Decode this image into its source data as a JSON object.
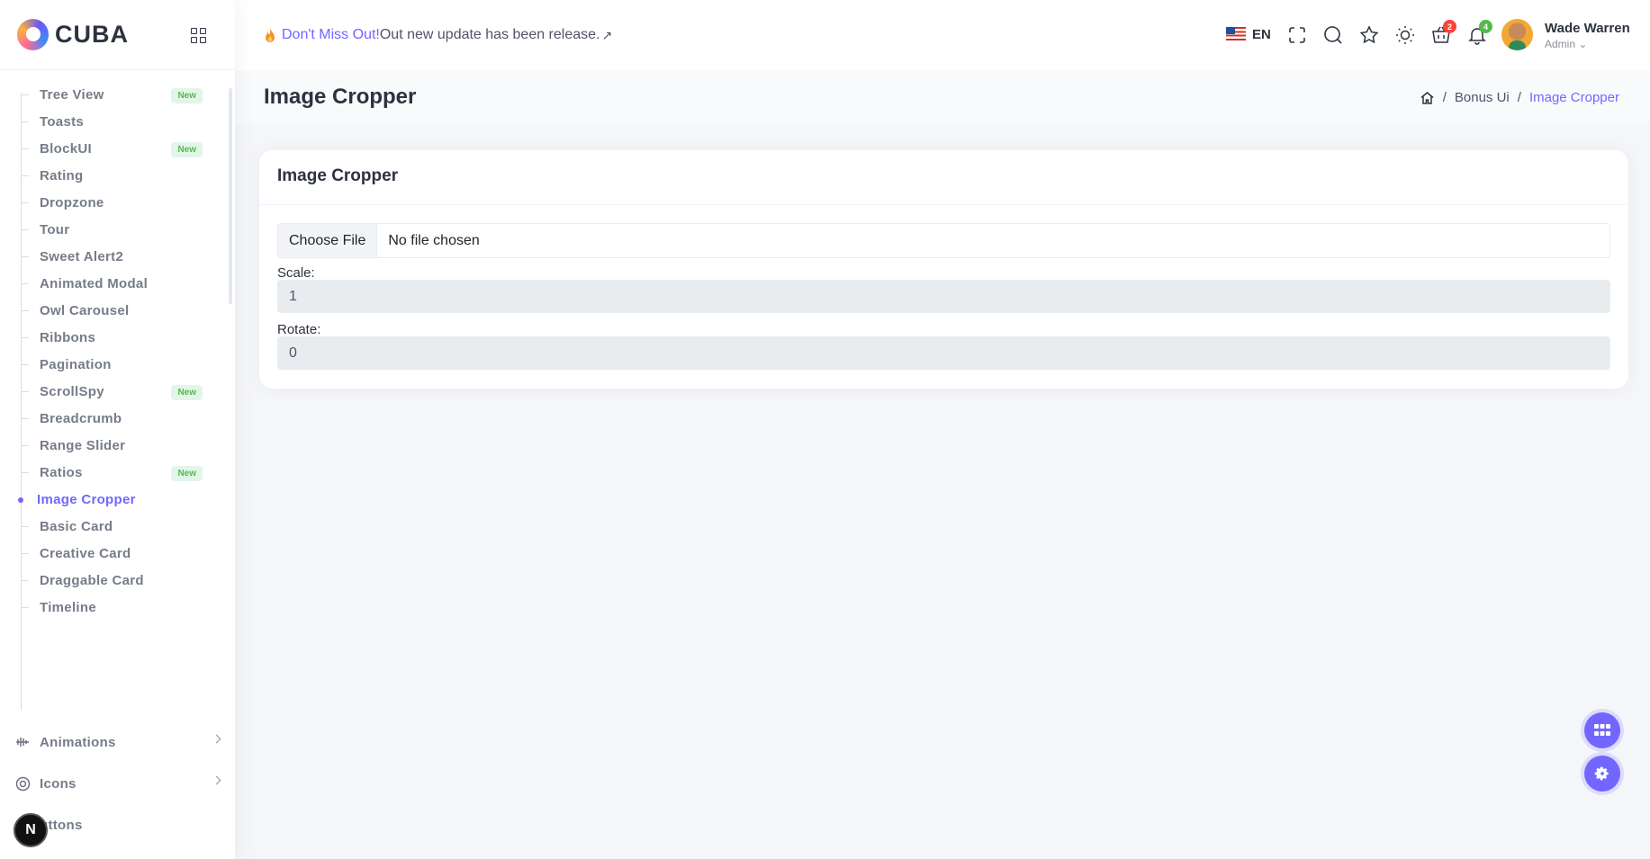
{
  "brand": {
    "name": "CUBA"
  },
  "sidebar": {
    "sub_items": [
      {
        "label": "Tree View",
        "badge": "New"
      },
      {
        "label": "Toasts",
        "badge": ""
      },
      {
        "label": "BlockUI",
        "badge": "New"
      },
      {
        "label": "Rating",
        "badge": ""
      },
      {
        "label": "Dropzone",
        "badge": ""
      },
      {
        "label": "Tour",
        "badge": ""
      },
      {
        "label": "Sweet Alert2",
        "badge": ""
      },
      {
        "label": "Animated Modal",
        "badge": ""
      },
      {
        "label": "Owl Carousel",
        "badge": ""
      },
      {
        "label": "Ribbons",
        "badge": ""
      },
      {
        "label": "Pagination",
        "badge": ""
      },
      {
        "label": "ScrollSpy",
        "badge": "New"
      },
      {
        "label": "Breadcrumb",
        "badge": ""
      },
      {
        "label": "Range Slider",
        "badge": ""
      },
      {
        "label": "Ratios",
        "badge": "New"
      },
      {
        "label": "Image Cropper",
        "badge": "",
        "active": true
      },
      {
        "label": "Basic Card",
        "badge": ""
      },
      {
        "label": "Creative Card",
        "badge": ""
      },
      {
        "label": "Draggable Card",
        "badge": ""
      },
      {
        "label": "Timeline",
        "badge": ""
      }
    ],
    "main_items": [
      {
        "label": "Animations",
        "icon": "animation-icon"
      },
      {
        "label": "Icons",
        "icon": "icons-icon"
      },
      {
        "label": "uttons",
        "icon": "buttons-icon"
      }
    ],
    "n_badge": "N"
  },
  "header": {
    "promo_highlight": "Don't Miss Out!",
    "promo_text": "Out new update has been release.",
    "promo_arrow": "↗",
    "language": "EN",
    "cart_count": "2",
    "notification_count": "4",
    "user_name": "Wade Warren",
    "user_role": "Admin"
  },
  "page": {
    "title": "Image Cropper",
    "breadcrumb": [
      "Bonus Ui",
      "Image Cropper"
    ]
  },
  "card": {
    "title": "Image Cropper",
    "file_button": "Choose File",
    "file_status": "No file chosen",
    "scale_label": "Scale:",
    "scale_value": "1",
    "rotate_label": "Rotate:",
    "rotate_value": "0"
  },
  "colors": {
    "primary": "#7366ff",
    "success": "#54ba4a",
    "danger": "#fc4438"
  }
}
